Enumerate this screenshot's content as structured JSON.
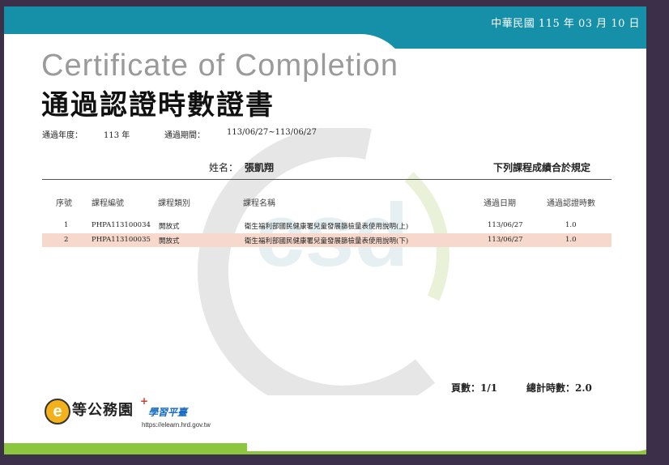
{
  "header": {
    "date": "中華民國 115 年 03 月 10 日"
  },
  "title": {
    "en": "Certificate of Completion",
    "zh": "通過認證時數證書"
  },
  "meta": {
    "year_label": "通過年度：",
    "year_value": "113 年",
    "period_label": "通過期間：",
    "period_value": "113/06/27~113/06/27"
  },
  "recipient": {
    "name_label": "姓名：",
    "name_value": "張凱翔",
    "statement": "下列課程成績合於規定"
  },
  "table": {
    "headers": [
      "序號",
      "課程編號",
      "課程類別",
      "課程名稱",
      "通過日期",
      "通過認證時數"
    ],
    "rows": [
      [
        "1",
        "PHPA113100034",
        "開放式",
        "衛生福利部國民健康署兒童發展篩檢量表使用說明(上)",
        "113/06/27",
        "1.0"
      ],
      [
        "2",
        "PHPA113100035",
        "開放式",
        "衛生福利部國民健康署兒童發展篩檢量表使用說明(下)",
        "113/06/27",
        "1.0"
      ]
    ]
  },
  "totals": {
    "pages": "頁數：1/1",
    "hours": "總計時數：2.0"
  },
  "logo": {
    "letter": "e",
    "name": "等公務園",
    "plus": "+",
    "sub": "學習平臺",
    "url": "https://elearn.hrd.gov.tw"
  },
  "colors": {
    "header": "#1590a8",
    "footer": "#8cc63f",
    "highlight_row": "#f6d9cc"
  }
}
